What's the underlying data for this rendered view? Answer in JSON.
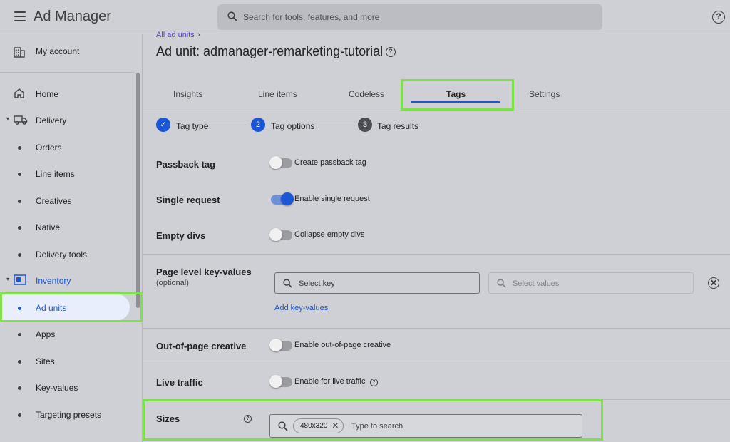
{
  "app": {
    "title": "Ad Manager"
  },
  "search": {
    "placeholder": "Search for tools, features, and more"
  },
  "sidebar": {
    "account": "My account",
    "items": [
      {
        "label": "Home"
      },
      {
        "label": "Delivery"
      },
      {
        "label": "Orders"
      },
      {
        "label": "Line items"
      },
      {
        "label": "Creatives"
      },
      {
        "label": "Native"
      },
      {
        "label": "Delivery tools"
      },
      {
        "label": "Inventory"
      },
      {
        "label": "Ad units"
      },
      {
        "label": "Apps"
      },
      {
        "label": "Sites"
      },
      {
        "label": "Key-values"
      },
      {
        "label": "Targeting presets"
      }
    ]
  },
  "breadcrumb": {
    "link": "All ad units",
    "sep": "›"
  },
  "page": {
    "title": "Ad unit: admanager-remarketing-tutorial"
  },
  "tabs": [
    "Insights",
    "Line items",
    "Codeless",
    "Tags",
    "Settings"
  ],
  "steps": [
    {
      "num": "✓",
      "label": "Tag type"
    },
    {
      "num": "2",
      "label": "Tag options"
    },
    {
      "num": "3",
      "label": "Tag results"
    }
  ],
  "options": {
    "passback": {
      "label": "Passback tag",
      "toggle": "Create passback tag",
      "on": false
    },
    "single": {
      "label": "Single request",
      "toggle": "Enable single request",
      "on": true
    },
    "empty": {
      "label": "Empty divs",
      "toggle": "Collapse empty divs",
      "on": false
    },
    "kv": {
      "label": "Page level key-values",
      "sub": "(optional)",
      "key_placeholder": "Select key",
      "values_placeholder": "Select values",
      "add": "Add key-values"
    },
    "oop": {
      "label": "Out-of-page creative",
      "toggle": "Enable out-of-page creative",
      "on": false
    },
    "live": {
      "label": "Live traffic",
      "toggle": "Enable for live traffic",
      "on": false
    },
    "sizes": {
      "label": "Sizes",
      "chip": "480x320",
      "placeholder": "Type to search"
    }
  },
  "colors": {
    "accent": "#1a56d6",
    "highlight": "#7ee14a",
    "background": "#cfd0d5"
  }
}
